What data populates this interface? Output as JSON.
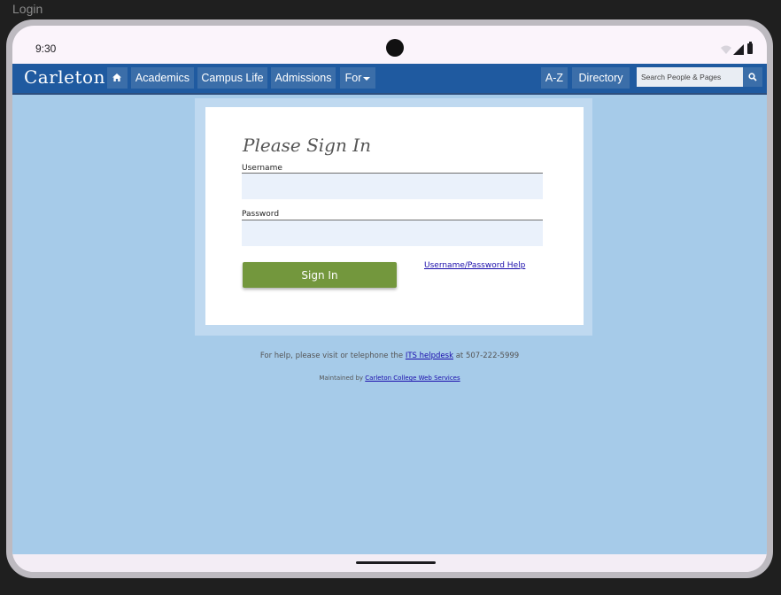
{
  "window": {
    "title": "Login"
  },
  "status_bar": {
    "time": "9:30"
  },
  "navbar": {
    "brand": "Carleton",
    "items": [
      {
        "label": "Academics"
      },
      {
        "label": "Campus Life"
      },
      {
        "label": "Admissions"
      },
      {
        "label": "For"
      }
    ],
    "right_items": [
      {
        "label": "A-Z"
      },
      {
        "label": "Directory"
      }
    ],
    "search_placeholder": "Search People & Pages"
  },
  "login": {
    "title": "Please Sign In",
    "username_label": "Username",
    "username_value": "",
    "password_label": "Password",
    "password_value": "",
    "submit_label": "Sign In",
    "help_link": "Username/Password Help"
  },
  "footer": {
    "help_prefix": "For help, please visit or telephone the ",
    "help_link": "ITS helpdesk",
    "help_suffix": " at 507-222-5999",
    "maintained_prefix": "Maintained by ",
    "maintained_link": "Carleton College Web Services"
  },
  "colors": {
    "navbar": "#1f5aa0",
    "page_background": "#a6cbe9",
    "sign_in_button": "#73973d"
  }
}
